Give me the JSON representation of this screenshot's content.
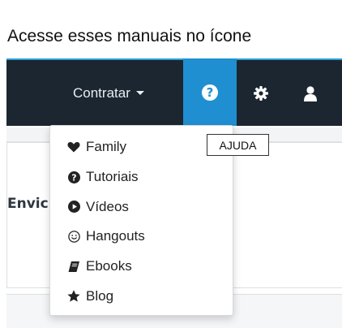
{
  "caption": "Acesse esses manuais no ícone",
  "navbar": {
    "contratar_label": "Contratar",
    "help_glyph": "?",
    "accent_color": "#1f8fd1",
    "bar_color": "#1c2630"
  },
  "panel": {
    "text": "Envic"
  },
  "dropdown": {
    "items": [
      {
        "label": "Family",
        "icon": "heart-icon"
      },
      {
        "label": "Tutoriais",
        "icon": "question-circle-icon"
      },
      {
        "label": "Vídeos",
        "icon": "play-circle-icon"
      },
      {
        "label": "Hangouts",
        "icon": "smiley-icon"
      },
      {
        "label": "Ebooks",
        "icon": "book-icon"
      },
      {
        "label": "Blog",
        "icon": "star-icon"
      }
    ]
  },
  "tooltip": {
    "text": "AJUDA"
  }
}
